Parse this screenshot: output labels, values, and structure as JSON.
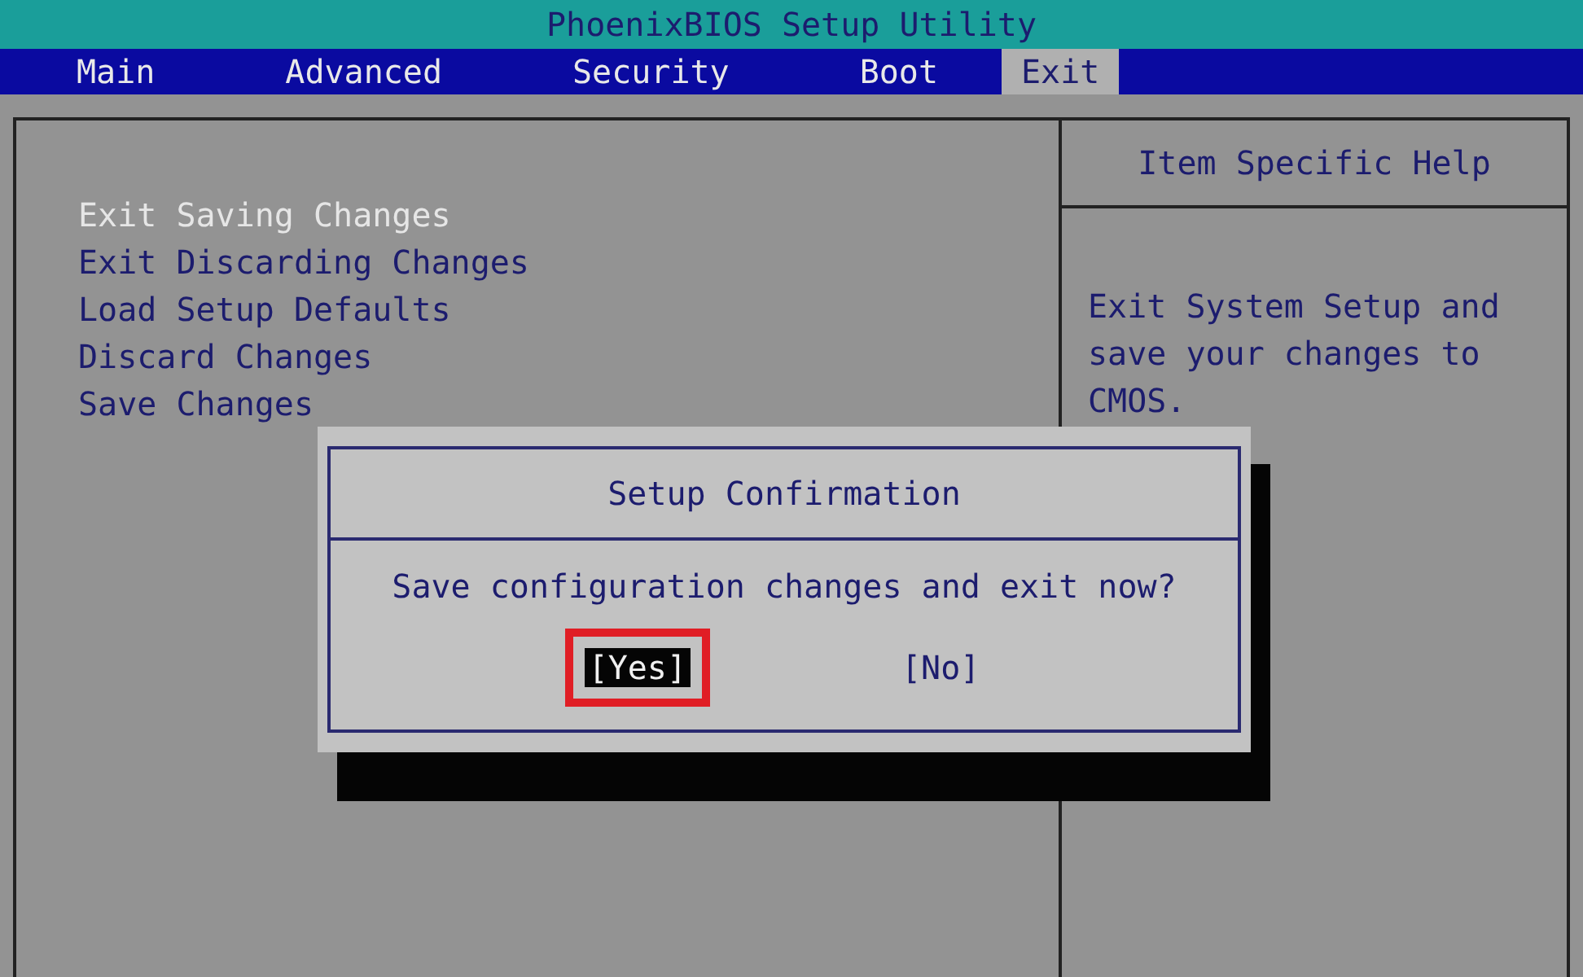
{
  "title": "PhoenixBIOS Setup Utility",
  "tabs": [
    {
      "label": "Main",
      "selected": false
    },
    {
      "label": "Advanced",
      "selected": false
    },
    {
      "label": "Security",
      "selected": false
    },
    {
      "label": "Boot",
      "selected": false
    },
    {
      "label": "Exit",
      "selected": true
    }
  ],
  "menu": [
    {
      "label": "Exit Saving Changes",
      "selected": true
    },
    {
      "label": "Exit Discarding Changes",
      "selected": false
    },
    {
      "label": "Load Setup Defaults",
      "selected": false
    },
    {
      "label": "Discard Changes",
      "selected": false
    },
    {
      "label": "Save Changes",
      "selected": false
    }
  ],
  "help": {
    "title": "Item Specific Help",
    "text": "Exit System Setup and save your changes to CMOS."
  },
  "dialog": {
    "title": "Setup Confirmation",
    "message": "Save configuration changes and exit now?",
    "buttons": [
      {
        "label": "[Yes]",
        "selected": true
      },
      {
        "label": "[No]",
        "selected": false
      }
    ]
  }
}
